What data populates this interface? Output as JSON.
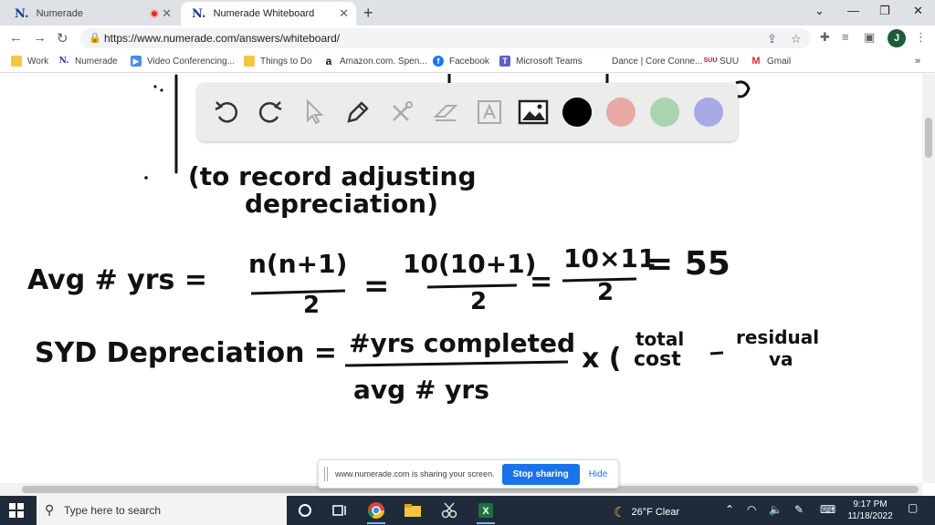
{
  "browser": {
    "tabs": [
      {
        "label": "Numerade",
        "favicon": "N."
      },
      {
        "label": "Numerade Whiteboard",
        "favicon": "N."
      }
    ],
    "url": "https://www.numerade.com/answers/whiteboard/",
    "profile_initial": "J"
  },
  "bookmarks": [
    {
      "label": "Work",
      "icon": "folder-icon"
    },
    {
      "label": "Numerade",
      "icon": "N."
    },
    {
      "label": "Video Conferencing...",
      "icon": "video-icon"
    },
    {
      "label": "Things to Do",
      "icon": "folder-icon"
    },
    {
      "label": "Amazon.com. Spen...",
      "icon": "a"
    },
    {
      "label": "Facebook",
      "icon": "facebook-icon"
    },
    {
      "label": "Microsoft Teams",
      "icon": "teams-icon"
    },
    {
      "label": "Dance | Core Conne...",
      "icon": "globe-icon"
    },
    {
      "label": "SUU",
      "icon": "SUU"
    },
    {
      "label": "Gmail",
      "icon": "M"
    }
  ],
  "whiteboard": {
    "colors": [
      "#000000",
      "#e8a8a4",
      "#a8d5b0",
      "#a9a9e8"
    ],
    "ink": {
      "line1": "(to record adjusting",
      "line2": "depreciation)",
      "avg_lhs": "Avg # yrs =",
      "n_num": "n(n+1)",
      "den2": "2",
      "ten_num": "10(10+1)",
      "ten11_num": "10×11",
      "result": "= 55",
      "syd_lhs": "SYD Depreciation =",
      "syd_num": "#yrs completed",
      "syd_den": "avg # yrs",
      "times": "x (",
      "total_top": "total",
      "cost_bottom": "cost",
      "residual_top": "residual",
      "residual_bottom": "va"
    }
  },
  "share_bar": {
    "message": "www.numerade.com is sharing your screen.",
    "stop_label": "Stop sharing",
    "hide_label": "Hide"
  },
  "taskbar": {
    "search_placeholder": "Type here to search",
    "weather": "26°F  Clear",
    "time": "9:17 PM",
    "date": "11/18/2022"
  }
}
